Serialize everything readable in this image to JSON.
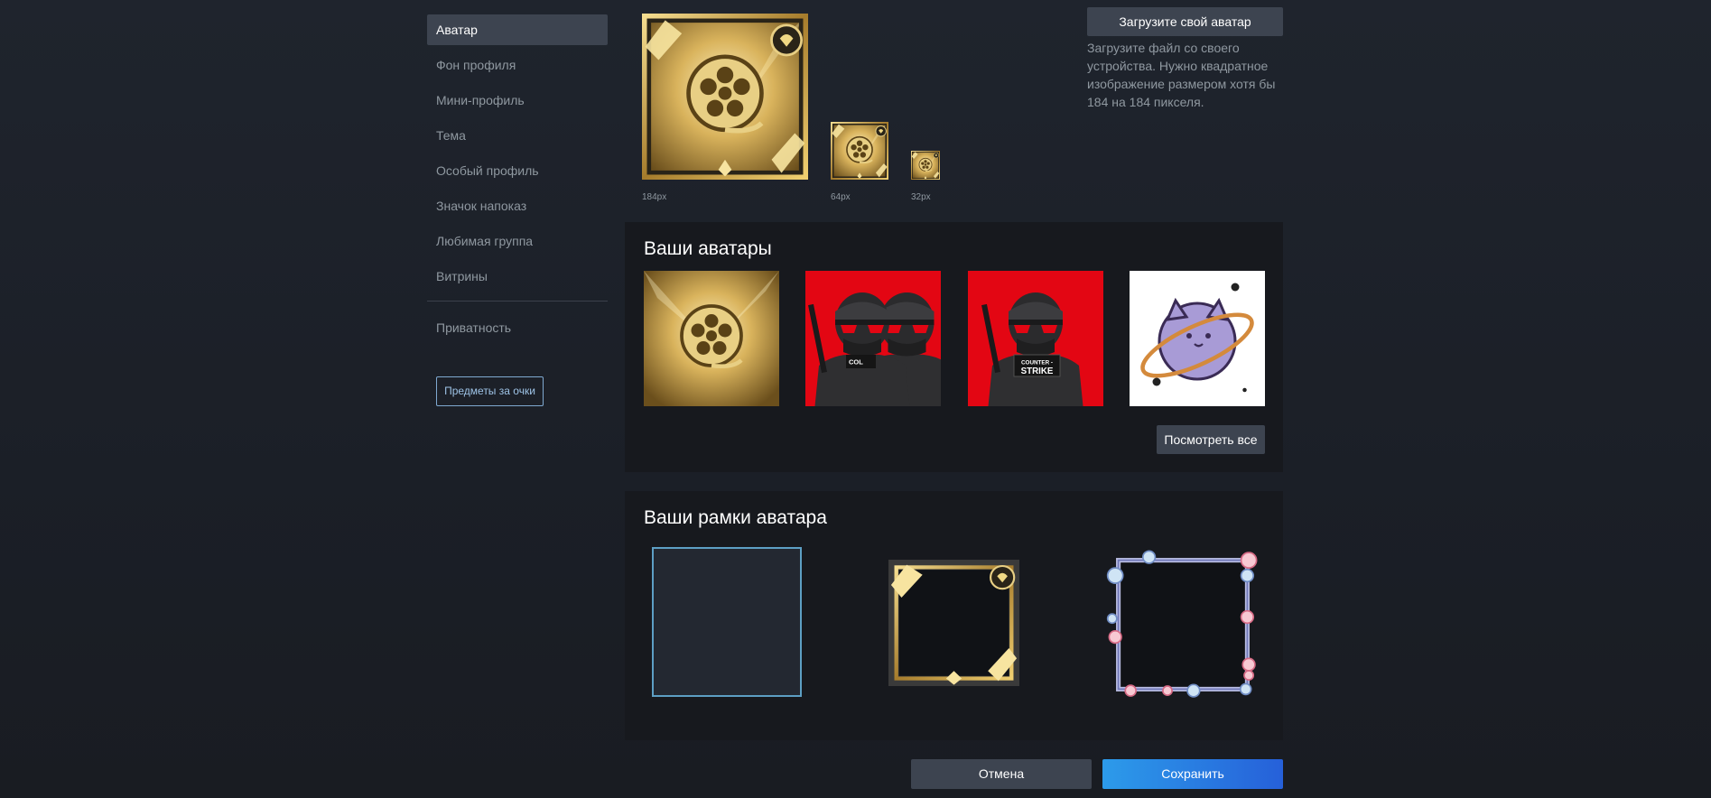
{
  "sidebar": {
    "items": [
      {
        "label": "Аватар",
        "active": true
      },
      {
        "label": "Фон профиля"
      },
      {
        "label": "Мини-профиль"
      },
      {
        "label": "Тема"
      },
      {
        "label": "Особый профиль"
      },
      {
        "label": "Значок напоказ"
      },
      {
        "label": "Любимая группа"
      },
      {
        "label": "Витрины"
      },
      {
        "label": "Приватность"
      }
    ],
    "points_button": "Предметы за очки"
  },
  "preview": {
    "sizes": [
      "184px",
      "64px",
      "32px"
    ],
    "upload_button": "Загрузите свой аватар",
    "upload_description": "Загрузите файл со своего устройства. Нужно квадратное изображение размером хотя бы 184 на 184 пикселя."
  },
  "avatars": {
    "title": "Ваши аватары",
    "items": [
      "film-reel-gold-avatar",
      "counter-strike-duo-avatar",
      "counter-strike-avatar",
      "cat-planet-avatar"
    ],
    "view_all_button": "Посмотреть все",
    "cs_sign_text": "COUNTER - STRIKE"
  },
  "frames": {
    "title": "Ваши рамки аватара",
    "items": [
      "no-frame",
      "gold-lightning-frame",
      "bubble-frame"
    ]
  },
  "actions": {
    "cancel": "Отмена",
    "save": "Сохранить"
  },
  "colors": {
    "accent_blue": "#2c9bea",
    "gold": "#d4b25a",
    "cs_red": "#e30613"
  }
}
